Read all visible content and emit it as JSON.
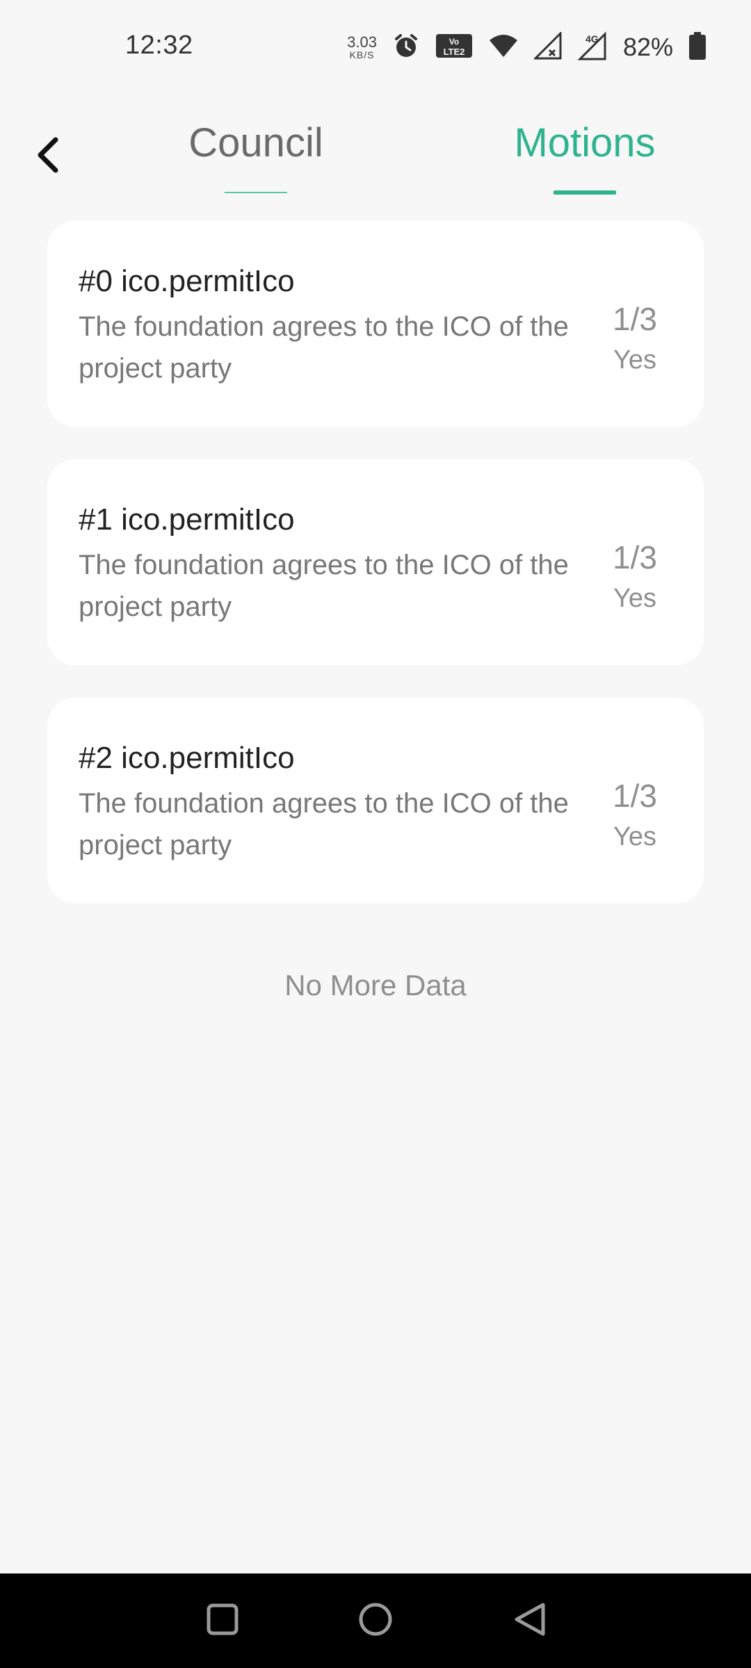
{
  "status_bar": {
    "time": "12:32",
    "net_speed_value": "3.03",
    "net_speed_unit": "KB/S",
    "battery_percent": "82%"
  },
  "header": {
    "tabs": [
      {
        "label": "Council",
        "active": false
      },
      {
        "label": "Motions",
        "active": true
      }
    ],
    "accent_color": "#2fb38f"
  },
  "motions": [
    {
      "title": "#0 ico.permitIco",
      "description": "The foundation agrees to the ICO of the project party",
      "vote_count": "1/3",
      "vote_status": "Yes"
    },
    {
      "title": "#1 ico.permitIco",
      "description": "The foundation agrees to the ICO of the project party",
      "vote_count": "1/3",
      "vote_status": "Yes"
    },
    {
      "title": "#2 ico.permitIco",
      "description": "The foundation agrees to the ICO of the project party",
      "vote_count": "1/3",
      "vote_status": "Yes"
    }
  ],
  "footer_text": "No More Data",
  "icons": {
    "back": "chevron-left-icon",
    "status": [
      "alarm-icon",
      "volte-icon",
      "wifi-icon",
      "signal-icon",
      "signal-4g-icon",
      "battery-icon"
    ],
    "nav": [
      "recents-square-icon",
      "home-circle-icon",
      "back-triangle-icon"
    ]
  }
}
